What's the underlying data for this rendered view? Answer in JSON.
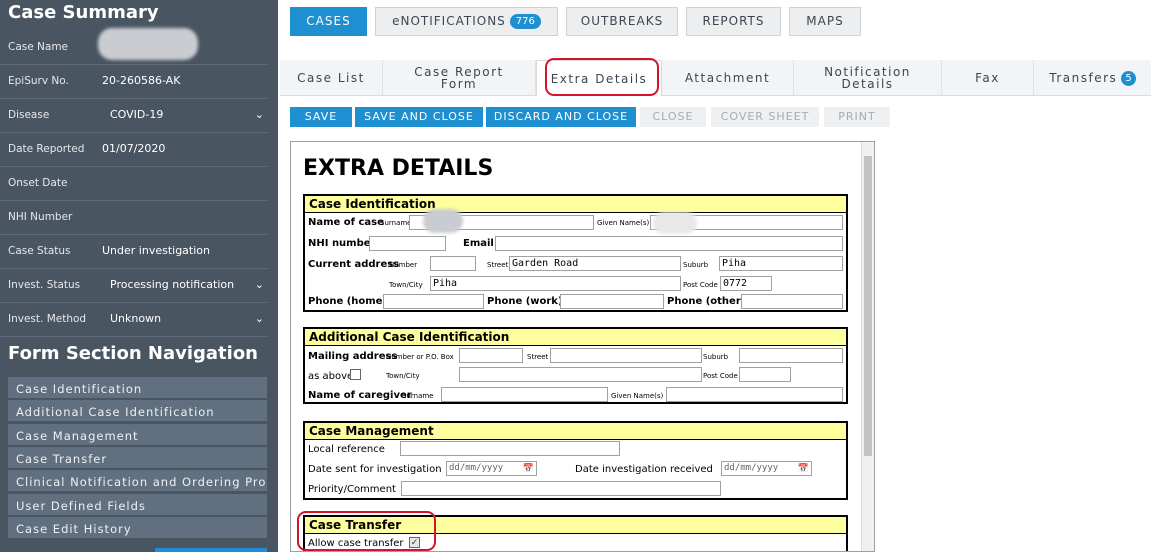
{
  "sidebar": {
    "title": "Case Summary",
    "rows": [
      {
        "label": "Case Name",
        "value": ""
      },
      {
        "label": "EpiSurv No.",
        "value": "20-260586-AK"
      },
      {
        "label": "Disease",
        "value": "COVID-19"
      },
      {
        "label": "Date Reported",
        "value": "01/07/2020"
      },
      {
        "label": "Onset Date",
        "value": ""
      },
      {
        "label": "NHI Number",
        "value": ""
      },
      {
        "label": "Case Status",
        "value": "Under investigation"
      },
      {
        "label": "Invest. Status",
        "value": "Processing notification"
      },
      {
        "label": "Invest. Method",
        "value": "Unknown"
      }
    ],
    "nav_title": "Form Section Navigation",
    "nav_items": [
      "Case Identification",
      "Additional Case Identification",
      "Case Management",
      "Case Transfer",
      "Clinical Notification and Ordering Pro...",
      "User Defined Fields",
      "Case Edit History"
    ]
  },
  "top_nav": {
    "items": [
      "CASES",
      "eNOTIFICATIONS",
      "OUTBREAKS",
      "REPORTS",
      "MAPS"
    ],
    "enotifications_count": "776"
  },
  "tabs": {
    "items": [
      "Case List",
      "Case Report Form",
      "Extra Details",
      "Attachment",
      "Notification Details",
      "Fax",
      "Transfers"
    ],
    "transfers_count": "5"
  },
  "actions": [
    "SAVE",
    "SAVE AND CLOSE",
    "DISCARD AND CLOSE",
    "CLOSE",
    "COVER SHEET",
    "PRINT"
  ],
  "form": {
    "title": "EXTRA DETAILS",
    "case_identification": {
      "heading": "Case Identification",
      "name_of_case": "Name of case",
      "surname": "Surname",
      "given_names": "Given Name(s)",
      "nhi_number": "NHI number",
      "email": "Email",
      "current_address": "Current address",
      "number": "Number",
      "street": "Street",
      "street_value": "Garden Road",
      "suburb": "Suburb",
      "suburb_value": "Piha",
      "town_city": "Town/City",
      "town_value": "Piha",
      "post_code": "Post Code",
      "post_code_value": "0772",
      "phone_home": "Phone (home)",
      "phone_work": "Phone (work)",
      "phone_other": "Phone (other)"
    },
    "additional_identification": {
      "heading": "Additional Case Identification",
      "mailing_address": "Mailing address",
      "number_po": "Number or P.O. Box",
      "street": "Street",
      "suburb": "Suburb",
      "as_above": "as above",
      "town_city": "Town/City",
      "post_code": "Post Code",
      "caregiver": "Name of caregiver",
      "surname": "Surname",
      "given_names": "Given Name(s)"
    },
    "case_management": {
      "heading": "Case Management",
      "local_reference": "Local reference",
      "date_sent": "Date sent for investigation",
      "date_placeholder": "dd/mm/yyyy",
      "date_received": "Date investigation received",
      "priority": "Priority/Comment"
    },
    "case_transfer": {
      "heading": "Case Transfer",
      "allow": "Allow case transfer"
    }
  },
  "colors": {
    "sidebar_bg": "#4a5562",
    "accent": "#1e8fd1",
    "section_header": "#fefe9e",
    "highlight": "#d4142a"
  }
}
